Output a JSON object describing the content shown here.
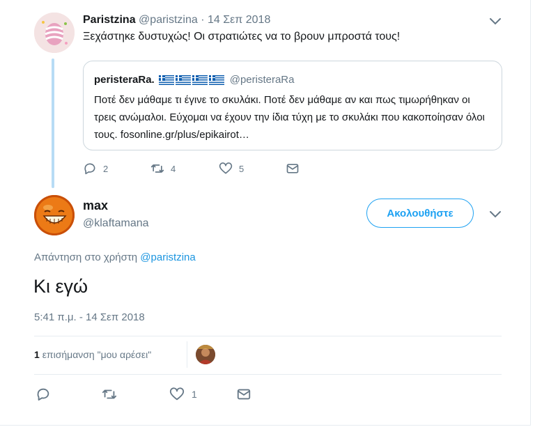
{
  "parent_tweet": {
    "name": "Paristzina",
    "handle": "@paristzina",
    "separator": "·",
    "time": "14 Σεπ 2018",
    "text": "Ξεχάστηκε δυστυχώς! Οι στρατιώτες να το βρουν μπροστά τους!",
    "quote": {
      "name": "peristeraRa.",
      "handle": "@peristeraRa",
      "text": "Ποτέ δεν μάθαμε τι έγινε το σκυλάκι. Ποτέ δεν μάθαμε αν και πως τιμωρήθηκαν οι τρεις ανώμαλοι.  Εύχομαι να έχουν την ίδια τύχη με το σκυλάκι που κακοποίησαν όλοι τους.  fosonline.gr/plus/epikairot…"
    },
    "actions": {
      "replies": "2",
      "retweets": "4",
      "likes": "5"
    }
  },
  "main_tweet": {
    "name": "max",
    "handle": "@klaftamana",
    "follow_label": "Ακολουθήστε",
    "reply_prefix": "Απάντηση στο χρήστη",
    "reply_handle": "@paristzina",
    "text": "Κι εγώ",
    "timestamp": "5:41 π.μ. - 14 Σεπ 2018",
    "likes_count": "1",
    "likes_label": "επισήμανση \"μου αρέσει\"",
    "actions": {
      "replies": "",
      "retweets": "",
      "likes": "1"
    }
  },
  "colors": {
    "accent": "#1da1f2",
    "link": "#1b95e0",
    "muted": "#657786",
    "thread_line": "#b7dcf5"
  },
  "icons": [
    "reply-icon",
    "retweet-icon",
    "like-icon",
    "message-icon",
    "chevron-down-icon",
    "greek-flag-icon"
  ]
}
